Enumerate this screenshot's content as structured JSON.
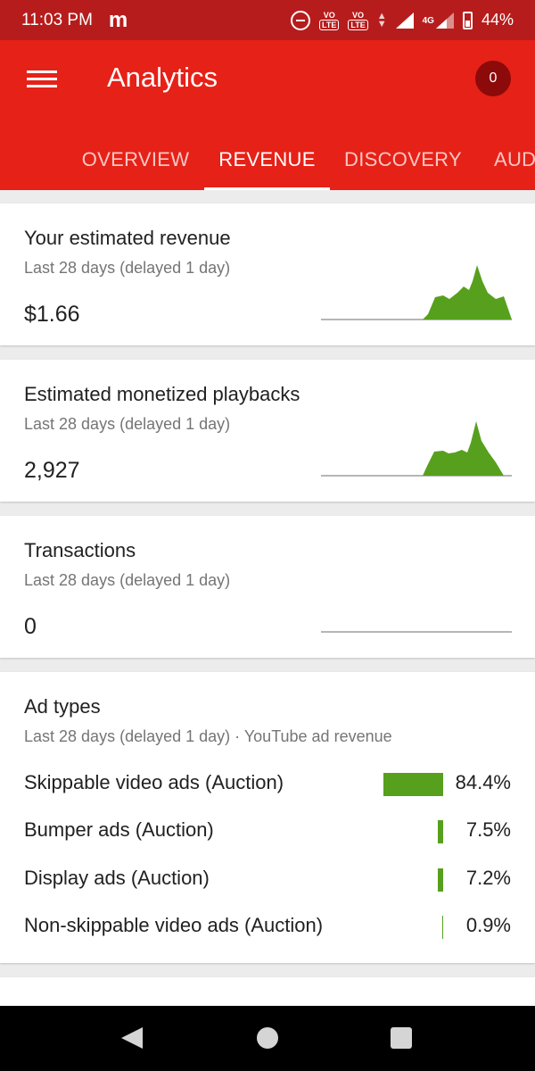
{
  "status_bar": {
    "time": "11:03 PM",
    "app_glyph": "m",
    "volte1": "VO",
    "volte1_sub": "LTE",
    "volte2": "VO",
    "volte2_sub": "LTE",
    "network": "4G",
    "battery": "44%"
  },
  "app_bar": {
    "title": "Analytics",
    "notification_count": "0",
    "icon": "menu-icon"
  },
  "tabs": [
    {
      "label": "OVERVIEW",
      "active": false
    },
    {
      "label": "REVENUE",
      "active": true
    },
    {
      "label": "DISCOVERY",
      "active": false
    },
    {
      "label": "AUDIENCE",
      "active": false
    }
  ],
  "cards": {
    "revenue": {
      "title": "Your estimated revenue",
      "subtitle": "Last 28 days (delayed 1 day)",
      "value": "$1.66"
    },
    "playbacks": {
      "title": "Estimated monetized playbacks",
      "subtitle": "Last 28 days (delayed 1 day)",
      "value": "2,927"
    },
    "transactions": {
      "title": "Transactions",
      "subtitle": "Last 28 days (delayed 1 day)",
      "value": "0"
    },
    "ad_types": {
      "title": "Ad types",
      "subtitle": "Last 28 days (delayed 1 day) · YouTube ad revenue",
      "rows": [
        {
          "label": "Skippable video ads (Auction)",
          "percent": "84.4%",
          "value": 84.4
        },
        {
          "label": "Bumper ads (Auction)",
          "percent": "7.5%",
          "value": 7.5
        },
        {
          "label": "Display ads (Auction)",
          "percent": "7.2%",
          "value": 7.2
        },
        {
          "label": "Non-skippable video ads (Auction)",
          "percent": "0.9%",
          "value": 0.9
        }
      ]
    }
  },
  "colors": {
    "status_bar": "#b71c1c",
    "app_bar": "#e62117",
    "badge": "#8c0a0a",
    "chart_fill": "#57a01d"
  }
}
